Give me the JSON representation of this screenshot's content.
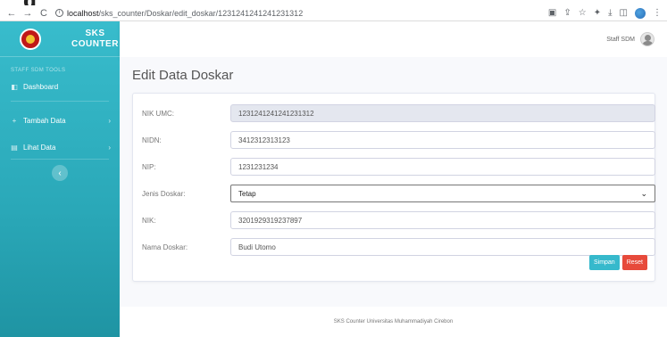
{
  "browser": {
    "top_clip_text": "g",
    "url_host": "localhost",
    "url_path": "/sks_counter/Doskar/edit_doskar/1231241241241231312"
  },
  "sidebar": {
    "brand_line1": "SKS",
    "brand_line2": "COUNTER",
    "heading": "STAFF SDM TOOLS",
    "items": [
      {
        "label": "Dashboard",
        "icon": "dashboard-icon",
        "glyph": "◧"
      },
      {
        "label": "Tambah Data",
        "icon": "plus-icon",
        "glyph": "+"
      },
      {
        "label": "Lihat Data",
        "icon": "file-icon",
        "glyph": "▤"
      }
    ],
    "toggle_glyph": "‹"
  },
  "topbar": {
    "user_name": "Staff SDM"
  },
  "page": {
    "title": "Edit Data Doskar"
  },
  "form": {
    "nik_umc": {
      "label": "NIK UMC:",
      "value": "1231241241241231312"
    },
    "nidn": {
      "label": "NIDN:",
      "value": "3412312313123"
    },
    "nip": {
      "label": "NIP:",
      "value": "1231231234"
    },
    "jenis_doskar": {
      "label": "Jenis Doskar:",
      "value": "Tetap"
    },
    "nik": {
      "label": "NIK:",
      "value": "3201929319237897"
    },
    "nama_doskar": {
      "label": "Nama Doskar:",
      "value": "Budi Utomo"
    },
    "save_label": "Simpan",
    "reset_label": "Reset"
  },
  "footer": {
    "text": "SKS Counter Universitas Muhammadiyah Cirebon"
  },
  "colors": {
    "sidebar": "#2aa8b8",
    "save": "#36b9cc",
    "reset": "#e74a3b"
  }
}
